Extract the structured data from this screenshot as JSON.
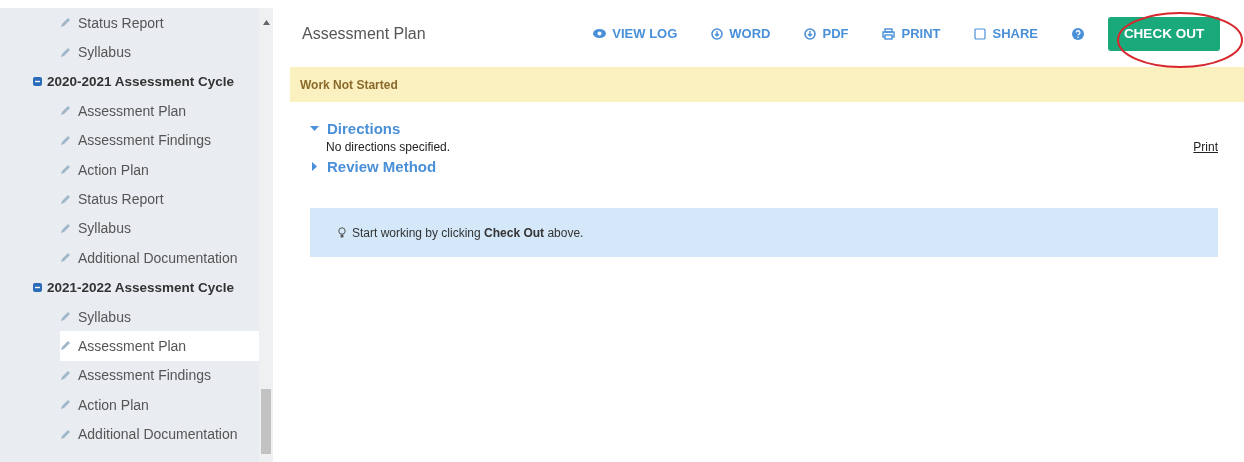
{
  "sidebar": {
    "items": [
      {
        "kind": "page",
        "label": "Status Report",
        "selected": false
      },
      {
        "kind": "page",
        "label": "Syllabus",
        "selected": false
      },
      {
        "kind": "cycle",
        "label": "2020-2021 Assessment Cycle",
        "expanded": true,
        "children": [
          {
            "kind": "page",
            "label": "Assessment Plan",
            "selected": false
          },
          {
            "kind": "page",
            "label": "Assessment Findings",
            "selected": false
          },
          {
            "kind": "page",
            "label": "Action Plan",
            "selected": false
          },
          {
            "kind": "page",
            "label": "Status Report",
            "selected": false
          },
          {
            "kind": "page",
            "label": "Syllabus",
            "selected": false
          },
          {
            "kind": "page",
            "label": "Additional Documentation",
            "selected": false
          }
        ]
      },
      {
        "kind": "cycle",
        "label": "2021-2022 Assessment Cycle",
        "expanded": true,
        "children": [
          {
            "kind": "page",
            "label": "Syllabus",
            "selected": false
          },
          {
            "kind": "page",
            "label": "Assessment Plan",
            "selected": true
          },
          {
            "kind": "page",
            "label": "Assessment Findings",
            "selected": false
          },
          {
            "kind": "page",
            "label": "Action Plan",
            "selected": false
          },
          {
            "kind": "page",
            "label": "Additional Documentation",
            "selected": false
          }
        ]
      }
    ]
  },
  "header": {
    "title": "Assessment Plan",
    "actions": [
      {
        "kind": "eye",
        "label": "VIEW LOG"
      },
      {
        "kind": "download",
        "label": "WORD"
      },
      {
        "kind": "download",
        "label": "PDF"
      },
      {
        "kind": "printer",
        "label": "PRINT"
      },
      {
        "kind": "checkbox",
        "label": "SHARE"
      },
      {
        "kind": "help"
      }
    ],
    "primary_button": "CHECK OUT"
  },
  "status_banner": "Work Not Started",
  "sections": [
    {
      "title": "Directions",
      "expanded": true,
      "body": "No directions specified."
    },
    {
      "title": "Review Method",
      "expanded": false
    }
  ],
  "print_link": "Print",
  "hint": "Start working by clicking **Check Out** above."
}
